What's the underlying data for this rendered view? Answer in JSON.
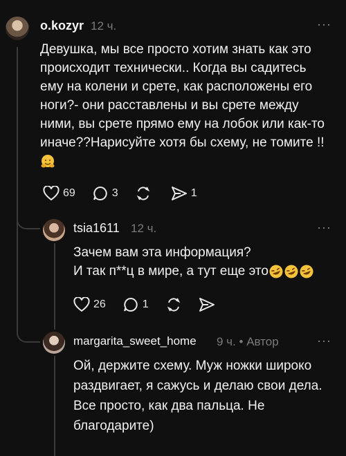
{
  "comments": [
    {
      "username": "o.kozyr",
      "time": "12 ч.",
      "lines": [
        "Девушка, мы все просто хотим знать как это",
        "происходит технически.. Когда вы садитесь",
        "ему на колени и срете, как расположены его",
        "ноги?- они расставлены и вы срете между",
        "ними, вы срете прямо ему на лобок или как-то",
        "иначе??Нарисуйте хотя бы схему, не томите !!"
      ],
      "emoji": "hugging-face",
      "likes": "69",
      "replies": "3",
      "reposts": "",
      "shares": "1"
    },
    {
      "username": "tsia1611",
      "time": "12 ч.",
      "lines": [
        "Зачем вам эта информация?",
        "И так п**ц в мире, а тут еще это"
      ],
      "trailing_emoji": "rolling-on-floor-laughing x3",
      "likes": "26",
      "replies": "1"
    },
    {
      "username": "margarita_sweet_home",
      "time": "9 ч.",
      "author_badge": "Автор",
      "lines": [
        "Ой, держите схему. Муж ножки широко",
        "раздвигает, я сажусь и делаю свои дела.",
        "Все просто, как два пальца. Не",
        "благодарите)"
      ]
    }
  ],
  "more_label": "···"
}
